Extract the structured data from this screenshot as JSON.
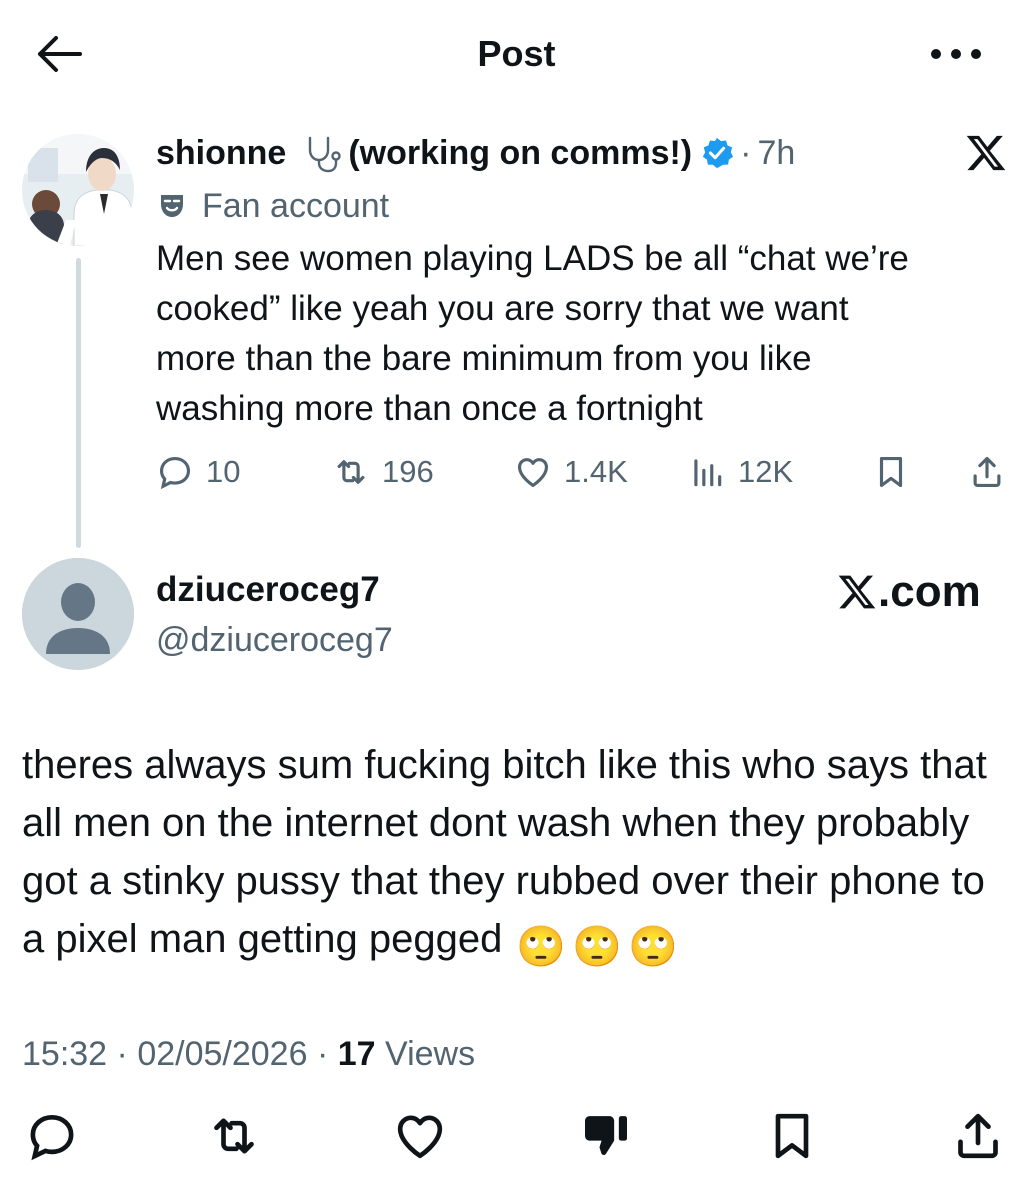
{
  "header": {
    "title": "Post"
  },
  "parent_tweet": {
    "display_name": "shionne",
    "name_suffix": "(working on comms!)",
    "time": "7h",
    "label": "Fan account",
    "text": "Men see women playing LADS be all “chat we’re\ncooked” like yeah you are sorry that we want\nmore than the bare minimum from you like\nwashing more than once a fortnight",
    "replies": "10",
    "reposts": "196",
    "likes": "1.4K",
    "views": "12K"
  },
  "reply_tweet": {
    "display_name": "dziuceroceg7",
    "handle": "@dziuceroceg7",
    "platform_label": ".com",
    "text": "theres always sum fucking bitch like this who says that all men on the internet dont wash when they probably got a stinky pussy that they rubbed over their phone to a pixel man getting pegged",
    "emojis": [
      "🙄",
      "🙄",
      "🙄"
    ],
    "time": "15:32",
    "date": "02/05/2026",
    "views_count": "17",
    "views_label": "Views"
  },
  "colors": {
    "text": "#0f1419",
    "secondary": "#536471",
    "verified": "#1d9bf0",
    "line": "#cfd9de"
  },
  "icons": {
    "back": "arrow-left-icon",
    "more": "more-horizontal-icon",
    "x_logo": "x-logo-icon",
    "verified": "verified-badge-icon",
    "stethoscope": "stethoscope-icon",
    "fan": "theater-masks-icon",
    "reply": "reply-icon",
    "repost": "repost-icon",
    "like": "heart-icon",
    "views": "analytics-icon",
    "bookmark": "bookmark-icon",
    "share": "share-icon",
    "dislike": "thumbs-down-icon"
  }
}
